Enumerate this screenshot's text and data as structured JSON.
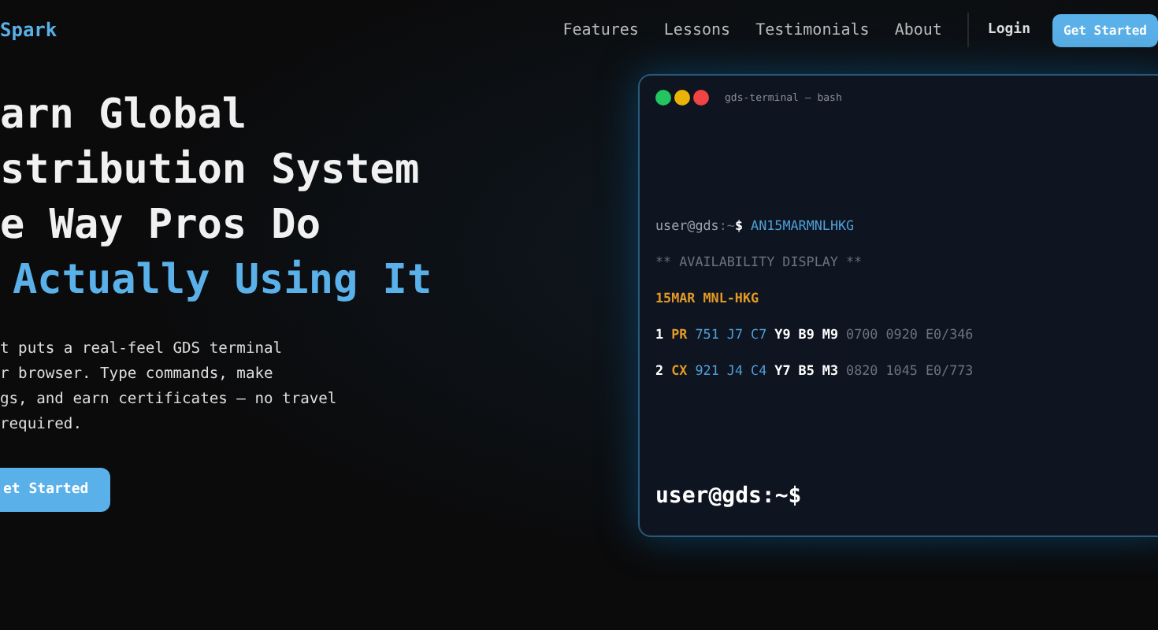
{
  "brand": "Spark",
  "nav": {
    "links": [
      "Features",
      "Lessons",
      "Testimonials",
      "About"
    ],
    "login": "Login",
    "cta": "Get Started"
  },
  "hero": {
    "headline": [
      "arn Global",
      "stribution System",
      "e Way Pros Do"
    ],
    "highlight": "Actually Using It",
    "description": [
      "t puts a real-feel GDS terminal",
      "r browser. Type commands, make",
      "gs, and earn certificates — no travel",
      "required."
    ],
    "button": "et Started"
  },
  "terminal": {
    "title": "gds-terminal — bash",
    "lines": [
      [
        {
          "kind": "prompt",
          "text": "user@gds"
        },
        {
          "kind": "muted",
          "text": ":~"
        },
        {
          "kind": "bold",
          "text": "$"
        },
        {
          "kind": "blue",
          "text": " AN15MARMNLHKG"
        }
      ],
      [
        {
          "kind": "muted",
          "text": "** AVAILABILITY DISPLAY **"
        }
      ],
      [
        {
          "kind": "orange",
          "text": "15MAR MNL-HKG"
        }
      ],
      [
        {
          "kind": "bold",
          "text": "1"
        },
        {
          "kind": "orange",
          "text": " PR"
        },
        {
          "kind": "blue",
          "text": " 751 J7 C7"
        },
        {
          "kind": "bold",
          "text": " Y9 B9 M9"
        },
        {
          "kind": "muted",
          "text": " 0700 0920 E0/346"
        }
      ],
      [
        {
          "kind": "bold",
          "text": "2"
        },
        {
          "kind": "orange",
          "text": " CX"
        },
        {
          "kind": "blue",
          "text": " 921 J4 C4"
        },
        {
          "kind": "bold",
          "text": " Y7 B5 M3"
        },
        {
          "kind": "muted",
          "text": " 0820 1045 E0/773"
        }
      ]
    ],
    "prompt": "user@gds:~$"
  }
}
